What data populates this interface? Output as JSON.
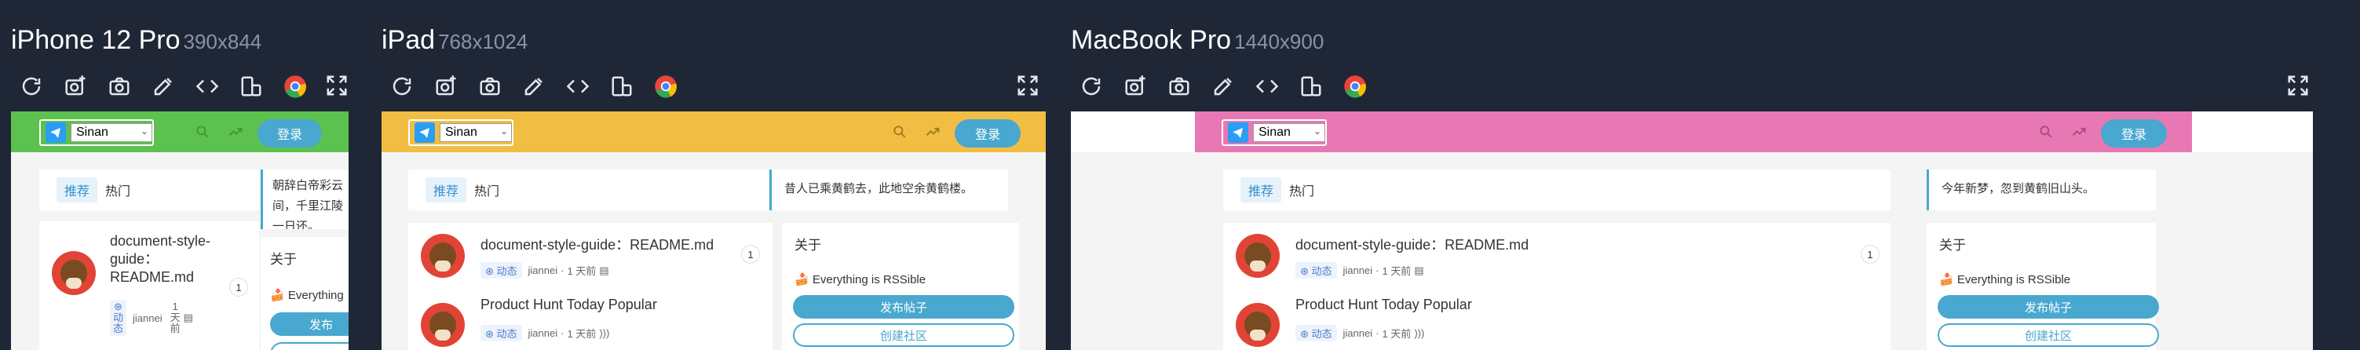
{
  "devices": [
    {
      "name": "iPhone 12 Pro",
      "size": "390x844",
      "header_color": "#5cc14f"
    },
    {
      "name": "iPad",
      "size": "768x1024",
      "header_color": "#f1be43"
    },
    {
      "name": "MacBook Pro",
      "size": "1440x900",
      "header_color": "#e878b3"
    }
  ],
  "site": {
    "selected_source": "Sinan",
    "login_label": "登录",
    "tabs": [
      "推荐",
      "热门"
    ],
    "quote_iphone": "朝辞白帝彩云间，千里江陵一日还。",
    "quote_ipad": "昔人已乘黄鹤去，此地空余黄鹤楼。",
    "quote_mac": "今年新梦，忽到黄鹤旧山头。",
    "posts": [
      {
        "title": "document-style-guide：README.md",
        "tag": "动态",
        "author": "jiannei",
        "time": "1 天前",
        "count": "1"
      },
      {
        "title": "Product Hunt Today Popular",
        "tag": "动态",
        "author": "jiannei",
        "time": "1 天前"
      }
    ],
    "iphone_title_lines": [
      "document-style-",
      "guide：",
      "README.md"
    ],
    "iphone_time_lines": [
      "1",
      "天",
      "前"
    ],
    "iphone_tag_lines": [
      "动",
      "态"
    ],
    "about_title": "关于",
    "about_text": "Everything is RSSible",
    "about_text_short": "Everything",
    "publish_label": "发布帖子",
    "publish_label_short": "发布",
    "create_label": "创建社区"
  }
}
